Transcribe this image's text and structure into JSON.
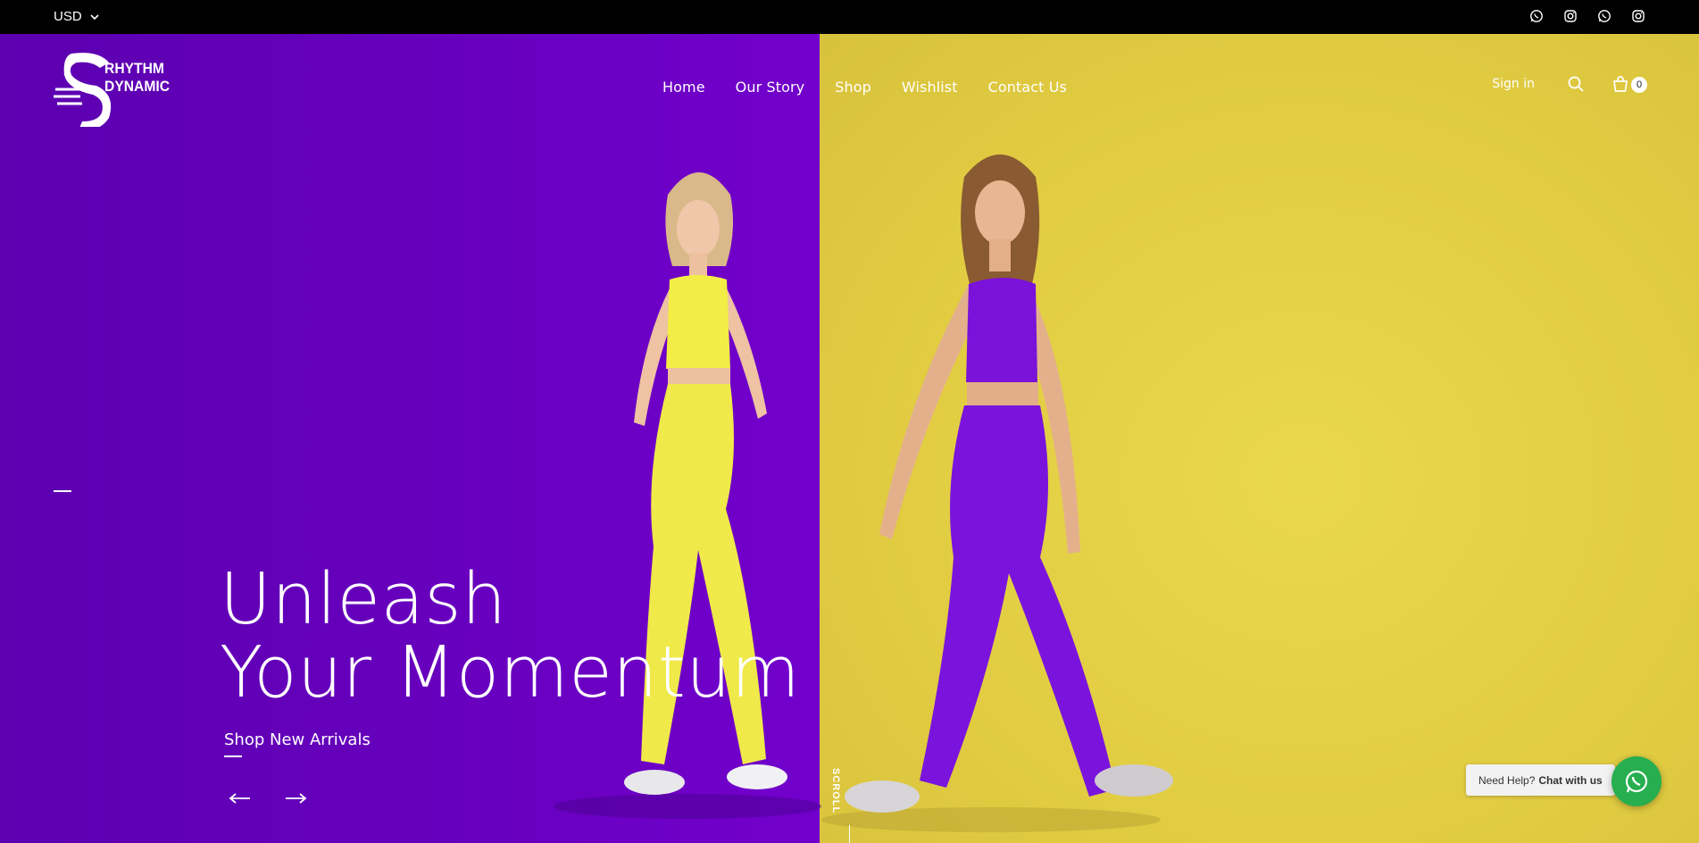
{
  "topbar": {
    "currency": "USD",
    "socials": [
      {
        "icon": "whatsapp-icon"
      },
      {
        "icon": "instagram-icon"
      },
      {
        "icon": "whatsapp-icon"
      },
      {
        "icon": "instagram-icon"
      }
    ]
  },
  "header": {
    "logo": {
      "line1": "RHYTHM",
      "line2": "DYNAMIC"
    },
    "nav": [
      "Home",
      "Our Story",
      "Shop",
      "Wishlist",
      "Contact Us"
    ],
    "sign_in": "Sign in",
    "cart_count": "0"
  },
  "hero": {
    "headline_line1": "Unleash",
    "headline_line2": "Your Momentum",
    "cta": "Shop New Arrivals",
    "scroll_label": "SCROLL"
  },
  "chat": {
    "prompt": "Need Help?",
    "action": "Chat with us"
  },
  "colors": {
    "left_background": "#6500bd",
    "right_background": "#e2cd42",
    "topbar": "#000000",
    "chat_button": "#27ae4f"
  }
}
